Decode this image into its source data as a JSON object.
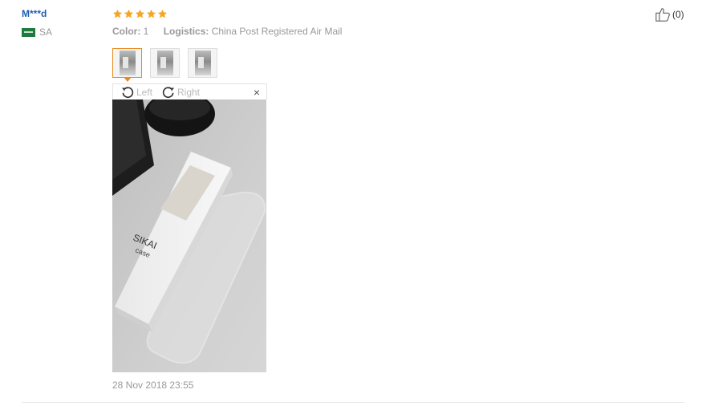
{
  "review": {
    "user": {
      "name": "M***d",
      "country": "SA"
    },
    "rating": 5,
    "color_label": "Color:",
    "color_value": "1",
    "logistics_label": "Logistics:",
    "logistics_value": "China Post Registered Air Mail",
    "thumbnails_count": 3,
    "viewer": {
      "rotate_left": "Left",
      "rotate_right": "Right",
      "close": "×"
    },
    "date": "28 Nov 2018 23:55",
    "useful_count": "(0)"
  },
  "colors": {
    "username": "#1f5db4",
    "star": "#f5a623",
    "active_border": "#e88a1e",
    "meta_text": "#999999"
  },
  "icons": [
    "flag-icon",
    "star-icon",
    "rotate-left-icon",
    "rotate-right-icon",
    "close-icon",
    "thumbs-up-icon"
  ]
}
